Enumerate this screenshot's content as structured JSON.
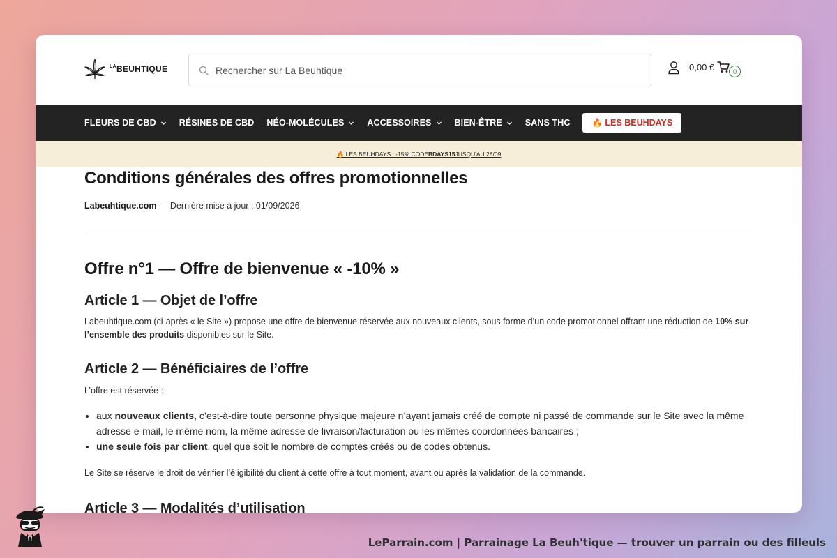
{
  "header": {
    "logo": {
      "prefix": "LA",
      "name": "BEUHTIQUE"
    },
    "search_placeholder": "Rechercher sur La Beuhtique",
    "cart_total": "0,00 €",
    "cart_count": "0"
  },
  "nav": {
    "items": [
      {
        "label": "FLEURS DE CBD",
        "has_dropdown": true
      },
      {
        "label": "RÉSINES DE CBD",
        "has_dropdown": false
      },
      {
        "label": "NÉO-MOLÉCULES",
        "has_dropdown": true
      },
      {
        "label": "ACCESSOIRES",
        "has_dropdown": true
      },
      {
        "label": "BIEN-ÊTRE",
        "has_dropdown": true
      },
      {
        "label": "SANS THC",
        "has_dropdown": false
      }
    ],
    "cta_label": "LES BEUHDAYS",
    "cta_color": "#d62a1e"
  },
  "promo": {
    "prefix": "🔥 LES BEUHDAYS : -15% CODE ",
    "code": "BDAYS15",
    "suffix": " JUSQU'AU 28/09"
  },
  "content": {
    "title": "Conditions générales des offres promotionnelles",
    "meta_site": "Labeuhtique.com",
    "meta_rest": " — Dernière mise à jour : 01/09/2026",
    "offer_title": "Offre n°1 — Offre de bienvenue « -10% »",
    "article1": {
      "title": "Article 1 — Objet de l’offre",
      "text_before": "Labeuhtique.com (ci-après « le Site ») propose une offre de bienvenue réservée aux nouveaux clients, sous forme d’un code promotionnel offrant une réduction de ",
      "text_bold": "10% sur l’ensemble des produits",
      "text_after": " disponibles sur le Site."
    },
    "article2": {
      "title": "Article 2 — Bénéficiaires de l’offre",
      "intro": "L’offre est réservée :",
      "items": [
        {
          "bold": "nouveaux clients",
          "before": "aux ",
          "after": ", c’est-à-dire toute personne physique majeure n’ayant jamais créé de compte ni passé de commande sur le Site avec la même adresse e-mail, le même nom, la même adresse de livraison/facturation ou les mêmes coordonnées bancaires ;"
        },
        {
          "bold": "une seule fois par client",
          "before": "",
          "after": ", quel que soit le nombre de comptes créés ou de codes obtenus."
        }
      ],
      "note": "Le Site se réserve le droit de vérifier l’éligibilité du client à cette offre à tout moment, avant ou après la validation de la commande."
    },
    "article3": {
      "title": "Article 3 — Modalités d’utilisation"
    }
  },
  "footer": {
    "credit": "LeParrain.com | Parrainage La Beuh'tique — trouver un parrain ou des filleuls"
  }
}
